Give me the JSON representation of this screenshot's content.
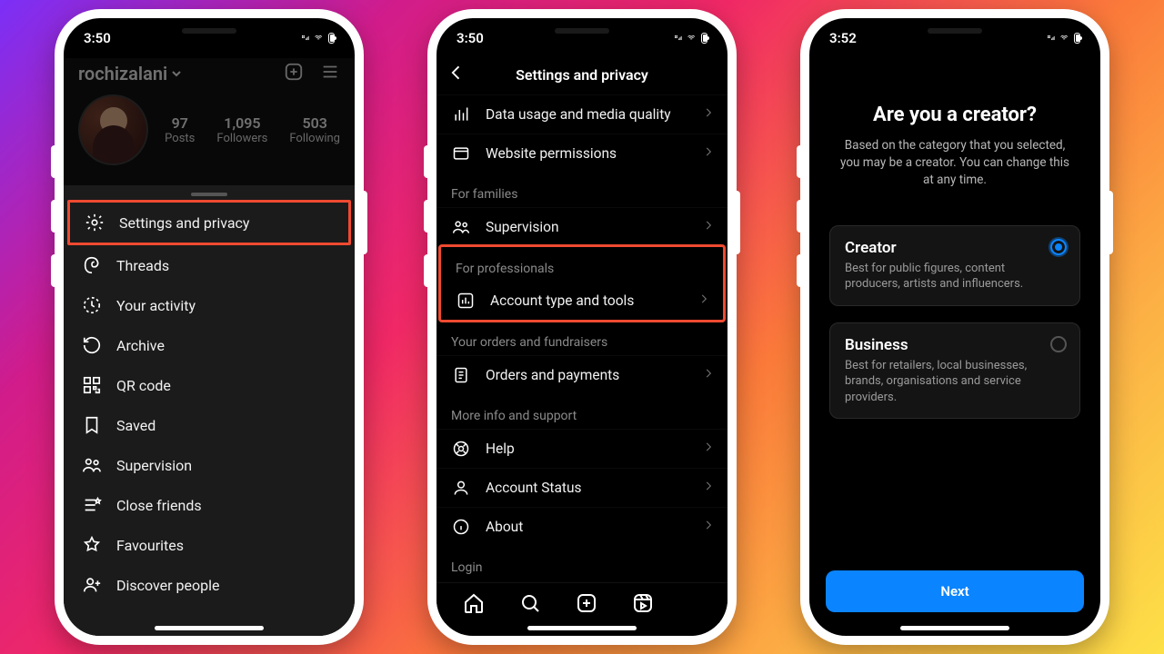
{
  "phone1": {
    "time": "3:50",
    "username": "rochizalani",
    "stats": {
      "posts_num": "97",
      "posts_label": "Posts",
      "followers_num": "1,095",
      "followers_label": "Followers",
      "following_num": "503",
      "following_label": "Following"
    },
    "menu": {
      "settings": "Settings and privacy",
      "threads": "Threads",
      "activity": "Your activity",
      "archive": "Archive",
      "qr": "QR code",
      "saved": "Saved",
      "supervision": "Supervision",
      "close_friends": "Close friends",
      "favourites": "Favourites",
      "discover": "Discover people"
    }
  },
  "phone2": {
    "time": "3:50",
    "title": "Settings and privacy",
    "rows": {
      "data_usage": "Data usage and media quality",
      "website_perm": "Website permissions",
      "supervision": "Supervision",
      "account_type": "Account type and tools",
      "orders": "Orders and payments",
      "help": "Help",
      "account_status": "Account Status",
      "about": "About",
      "login": "Login"
    },
    "sections": {
      "families": "For families",
      "professionals": "For professionals",
      "orders": "Your orders and fundraisers",
      "support": "More info and support"
    }
  },
  "phone3": {
    "time": "3:52",
    "title": "Are you a creator?",
    "subtitle": "Based on the category that you selected, you may be a creator. You can change this at any time.",
    "creator_title": "Creator",
    "creator_desc": "Best for public figures, content producers, artists and influencers.",
    "business_title": "Business",
    "business_desc": "Best for retailers, local businesses, brands, organisations and service providers.",
    "next": "Next"
  }
}
